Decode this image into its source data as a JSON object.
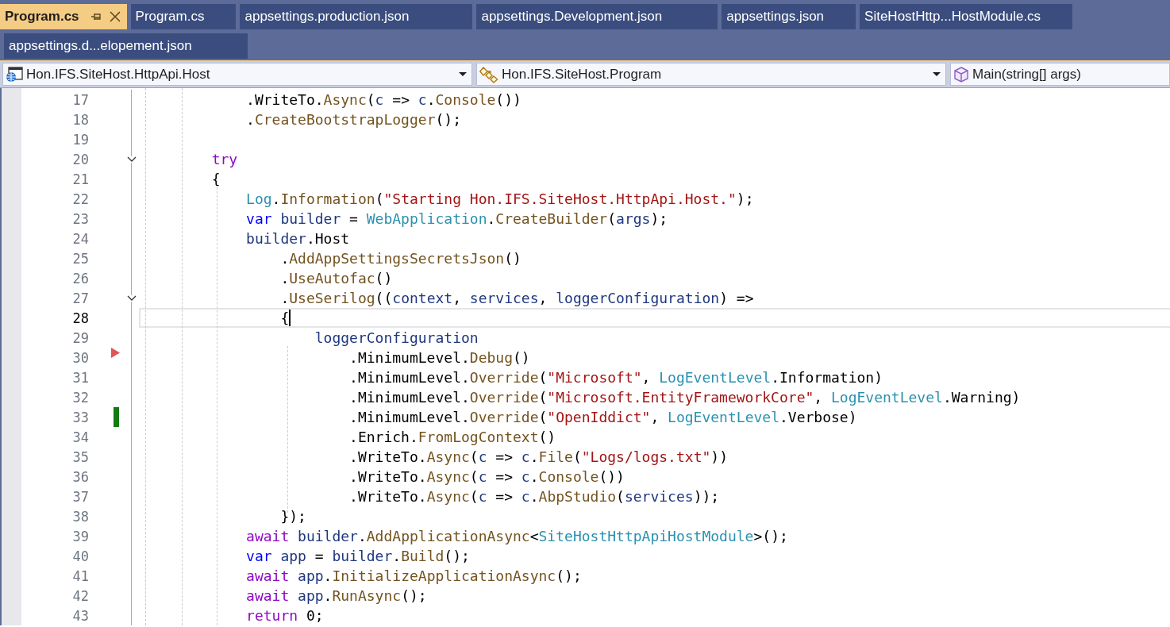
{
  "tab_rows": [
    [
      {
        "label": "Program.cs",
        "selected": true,
        "pinnable": true,
        "closable": true
      },
      {
        "label": "Program.cs",
        "selected": false
      },
      {
        "label": "appsettings.production.json",
        "selected": false
      },
      {
        "label": "appsettings.Development.json",
        "selected": false
      },
      {
        "label": "appsettings.json",
        "selected": false
      },
      {
        "label": "SiteHostHttp...HostModule.cs",
        "selected": false
      }
    ],
    [
      {
        "label": "appsettings.d...elopement.json",
        "selected": false
      }
    ]
  ],
  "navigation": [
    {
      "kind": "project",
      "text": "Hon.IFS.SiteHost.HttpApi.Host",
      "dropdown": true
    },
    {
      "kind": "class",
      "text": "Hon.IFS.SiteHost.Program",
      "dropdown": true
    },
    {
      "kind": "member",
      "text": "Main(string[] args)",
      "dropdown": false
    }
  ],
  "editor": {
    "lines": [
      {
        "number": "17",
        "current": false,
        "tokens": [
          {
            "kind": "plain",
            "text": "            .WriteTo."
          },
          {
            "kind": "method",
            "text": "Async"
          },
          {
            "kind": "plain",
            "text": "("
          },
          {
            "kind": "variable",
            "text": "c"
          },
          {
            "kind": "plain",
            "text": " => "
          },
          {
            "kind": "variable",
            "text": "c"
          },
          {
            "kind": "plain",
            "text": "."
          },
          {
            "kind": "method",
            "text": "Console"
          },
          {
            "kind": "plain",
            "text": "())"
          }
        ]
      },
      {
        "number": "18",
        "current": false,
        "tokens": [
          {
            "kind": "plain",
            "text": "            ."
          },
          {
            "kind": "method",
            "text": "CreateBootstrapLogger"
          },
          {
            "kind": "plain",
            "text": "();"
          }
        ]
      },
      {
        "number": "19",
        "current": false
      },
      {
        "number": "20",
        "current": false,
        "marker": {
          "kind": "fold"
        },
        "tokens": [
          {
            "kind": "control",
            "text": "        try"
          }
        ]
      },
      {
        "number": "21",
        "current": false,
        "tokens": [
          {
            "kind": "plain",
            "text": "        {"
          }
        ]
      },
      {
        "number": "22",
        "current": false,
        "tokens": [
          {
            "kind": "type",
            "text": "            Log"
          },
          {
            "kind": "plain",
            "text": "."
          },
          {
            "kind": "method",
            "text": "Information"
          },
          {
            "kind": "plain",
            "text": "("
          },
          {
            "kind": "string",
            "text": "\"Starting Hon.IFS.SiteHost.HttpApi.Host.\""
          },
          {
            "kind": "plain",
            "text": ");"
          }
        ]
      },
      {
        "number": "23",
        "current": false,
        "tokens": [
          {
            "kind": "keyword",
            "text": "            var "
          },
          {
            "kind": "variable",
            "text": "builder"
          },
          {
            "kind": "plain",
            "text": " = "
          },
          {
            "kind": "type",
            "text": "WebApplication"
          },
          {
            "kind": "plain",
            "text": "."
          },
          {
            "kind": "method",
            "text": "CreateBuilder"
          },
          {
            "kind": "plain",
            "text": "("
          },
          {
            "kind": "variable",
            "text": "args"
          },
          {
            "kind": "plain",
            "text": ");"
          }
        ]
      },
      {
        "number": "24",
        "current": false,
        "tokens": [
          {
            "kind": "variable",
            "text": "            builder"
          },
          {
            "kind": "plain",
            "text": ".Host"
          }
        ]
      },
      {
        "number": "25",
        "current": false,
        "tokens": [
          {
            "kind": "plain",
            "text": "                ."
          },
          {
            "kind": "method",
            "text": "AddAppSettingsSecretsJson"
          },
          {
            "kind": "plain",
            "text": "()"
          }
        ]
      },
      {
        "number": "26",
        "current": false,
        "tokens": [
          {
            "kind": "plain",
            "text": "                ."
          },
          {
            "kind": "method",
            "text": "UseAutofac"
          },
          {
            "kind": "plain",
            "text": "()"
          }
        ]
      },
      {
        "number": "27",
        "current": false,
        "marker": {
          "kind": "fold"
        },
        "tokens": [
          {
            "kind": "plain",
            "text": "                ."
          },
          {
            "kind": "method",
            "text": "UseSerilog"
          },
          {
            "kind": "plain",
            "text": "(("
          },
          {
            "kind": "variable",
            "text": "context"
          },
          {
            "kind": "plain",
            "text": ", "
          },
          {
            "kind": "variable",
            "text": "services"
          },
          {
            "kind": "plain",
            "text": ", "
          },
          {
            "kind": "variable",
            "text": "loggerConfiguration"
          },
          {
            "kind": "plain",
            "text": ") =>"
          }
        ]
      },
      {
        "number": "28",
        "current": true,
        "tokens": [
          {
            "kind": "plain",
            "text": "                {"
          }
        ]
      },
      {
        "number": "29",
        "current": false,
        "tokens": [
          {
            "kind": "variable",
            "text": "                    loggerConfiguration"
          }
        ]
      },
      {
        "number": "30",
        "current": false,
        "marker": {
          "kind": "arrow"
        },
        "tokens": [
          {
            "kind": "plain",
            "text": "                        .MinimumLevel."
          },
          {
            "kind": "method",
            "text": "Debug"
          },
          {
            "kind": "plain",
            "text": "()"
          }
        ]
      },
      {
        "number": "31",
        "current": false,
        "tokens": [
          {
            "kind": "plain",
            "text": "                        .MinimumLevel."
          },
          {
            "kind": "method",
            "text": "Override"
          },
          {
            "kind": "plain",
            "text": "("
          },
          {
            "kind": "string",
            "text": "\"Microsoft\""
          },
          {
            "kind": "plain",
            "text": ", "
          },
          {
            "kind": "type",
            "text": "LogEventLevel"
          },
          {
            "kind": "plain",
            "text": ".Information)"
          }
        ]
      },
      {
        "number": "32",
        "current": false,
        "tokens": [
          {
            "kind": "plain",
            "text": "                        .MinimumLevel."
          },
          {
            "kind": "method",
            "text": "Override"
          },
          {
            "kind": "plain",
            "text": "("
          },
          {
            "kind": "string",
            "text": "\"Microsoft.EntityFrameworkCore\""
          },
          {
            "kind": "plain",
            "text": ", "
          },
          {
            "kind": "type",
            "text": "LogEventLevel"
          },
          {
            "kind": "plain",
            "text": ".Warning)"
          }
        ]
      },
      {
        "number": "33",
        "current": false,
        "marker": {
          "kind": "change"
        },
        "tokens": [
          {
            "kind": "plain",
            "text": "                        .MinimumLevel."
          },
          {
            "kind": "method",
            "text": "Override"
          },
          {
            "kind": "plain",
            "text": "("
          },
          {
            "kind": "string",
            "text": "\"OpenIddict\""
          },
          {
            "kind": "plain",
            "text": ", "
          },
          {
            "kind": "type",
            "text": "LogEventLevel"
          },
          {
            "kind": "plain",
            "text": ".Verbose)"
          }
        ]
      },
      {
        "number": "34",
        "current": false,
        "tokens": [
          {
            "kind": "plain",
            "text": "                        .Enrich."
          },
          {
            "kind": "method",
            "text": "FromLogContext"
          },
          {
            "kind": "plain",
            "text": "()"
          }
        ]
      },
      {
        "number": "35",
        "current": false,
        "tokens": [
          {
            "kind": "plain",
            "text": "                        .WriteTo."
          },
          {
            "kind": "method",
            "text": "Async"
          },
          {
            "kind": "plain",
            "text": "("
          },
          {
            "kind": "variable",
            "text": "c"
          },
          {
            "kind": "plain",
            "text": " => "
          },
          {
            "kind": "variable",
            "text": "c"
          },
          {
            "kind": "plain",
            "text": "."
          },
          {
            "kind": "method",
            "text": "File"
          },
          {
            "kind": "plain",
            "text": "("
          },
          {
            "kind": "string",
            "text": "\"Logs/logs.txt\""
          },
          {
            "kind": "plain",
            "text": "))"
          }
        ]
      },
      {
        "number": "36",
        "current": false,
        "tokens": [
          {
            "kind": "plain",
            "text": "                        .WriteTo."
          },
          {
            "kind": "method",
            "text": "Async"
          },
          {
            "kind": "plain",
            "text": "("
          },
          {
            "kind": "variable",
            "text": "c"
          },
          {
            "kind": "plain",
            "text": " => "
          },
          {
            "kind": "variable",
            "text": "c"
          },
          {
            "kind": "plain",
            "text": "."
          },
          {
            "kind": "method",
            "text": "Console"
          },
          {
            "kind": "plain",
            "text": "())"
          }
        ]
      },
      {
        "number": "37",
        "current": false,
        "tokens": [
          {
            "kind": "plain",
            "text": "                        .WriteTo."
          },
          {
            "kind": "method",
            "text": "Async"
          },
          {
            "kind": "plain",
            "text": "("
          },
          {
            "kind": "variable",
            "text": "c"
          },
          {
            "kind": "plain",
            "text": " => "
          },
          {
            "kind": "variable",
            "text": "c"
          },
          {
            "kind": "plain",
            "text": "."
          },
          {
            "kind": "method",
            "text": "AbpStudio"
          },
          {
            "kind": "plain",
            "text": "("
          },
          {
            "kind": "variable",
            "text": "services"
          },
          {
            "kind": "plain",
            "text": "));"
          }
        ]
      },
      {
        "number": "38",
        "current": false,
        "tokens": [
          {
            "kind": "plain",
            "text": "                });"
          }
        ]
      },
      {
        "number": "39",
        "current": false,
        "tokens": [
          {
            "kind": "control",
            "text": "            await "
          },
          {
            "kind": "variable",
            "text": "builder"
          },
          {
            "kind": "plain",
            "text": "."
          },
          {
            "kind": "method",
            "text": "AddApplicationAsync"
          },
          {
            "kind": "plain",
            "text": "<"
          },
          {
            "kind": "type",
            "text": "SiteHostHttpApiHostModule"
          },
          {
            "kind": "plain",
            "text": ">();"
          }
        ]
      },
      {
        "number": "40",
        "current": false,
        "tokens": [
          {
            "kind": "keyword",
            "text": "            var "
          },
          {
            "kind": "variable",
            "text": "app"
          },
          {
            "kind": "plain",
            "text": " = "
          },
          {
            "kind": "variable",
            "text": "builder"
          },
          {
            "kind": "plain",
            "text": "."
          },
          {
            "kind": "method",
            "text": "Build"
          },
          {
            "kind": "plain",
            "text": "();"
          }
        ]
      },
      {
        "number": "41",
        "current": false,
        "tokens": [
          {
            "kind": "control",
            "text": "            await "
          },
          {
            "kind": "variable",
            "text": "app"
          },
          {
            "kind": "plain",
            "text": "."
          },
          {
            "kind": "method",
            "text": "InitializeApplicationAsync"
          },
          {
            "kind": "plain",
            "text": "();"
          }
        ]
      },
      {
        "number": "42",
        "current": false,
        "tokens": [
          {
            "kind": "control",
            "text": "            await "
          },
          {
            "kind": "variable",
            "text": "app"
          },
          {
            "kind": "plain",
            "text": "."
          },
          {
            "kind": "method",
            "text": "RunAsync"
          },
          {
            "kind": "plain",
            "text": "();"
          }
        ]
      },
      {
        "number": "43",
        "current": false,
        "tokens": [
          {
            "kind": "control",
            "text": "            return "
          },
          {
            "kind": "plain",
            "text": "0;"
          }
        ]
      }
    ]
  }
}
